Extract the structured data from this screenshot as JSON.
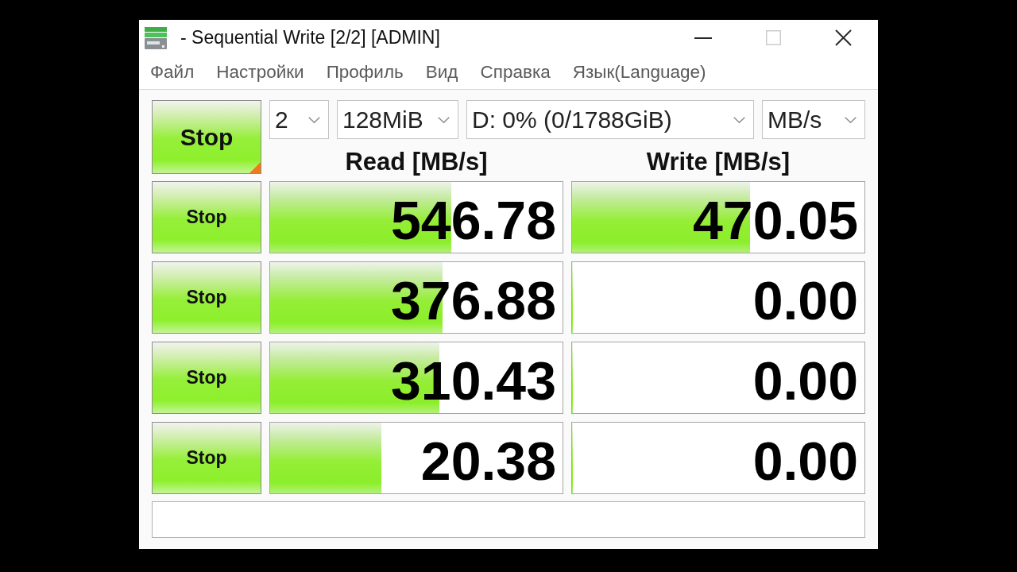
{
  "window": {
    "title": "- Sequential Write [2/2] [ADMIN]",
    "controls": [
      {
        "kind": "minimize",
        "disabled": false
      },
      {
        "kind": "maximize",
        "disabled": true
      },
      {
        "kind": "close",
        "disabled": false
      }
    ]
  },
  "menu": [
    "Файл",
    "Настройки",
    "Профиль",
    "Вид",
    "Справка",
    "Язык(Language)"
  ],
  "all_button": {
    "label": "Stop"
  },
  "settings": {
    "count": "2",
    "size": "128MiB",
    "drive": "D: 0% (0/1788GiB)",
    "unit": "MB/s"
  },
  "columns": [
    "Read [MB/s]",
    "Write [MB/s]"
  ],
  "tests": [
    {
      "button": "Stop",
      "read": {
        "value": "546.78",
        "level": 0.62
      },
      "write": {
        "value": "470.05",
        "level": 0.61
      }
    },
    {
      "button": "Stop",
      "read": {
        "value": "376.88",
        "level": 0.59
      },
      "write": {
        "value": "0.00",
        "level": 0
      }
    },
    {
      "button": "Stop",
      "read": {
        "value": "310.43",
        "level": 0.58
      },
      "write": {
        "value": "0.00",
        "level": 0
      }
    },
    {
      "button": "Stop",
      "read": {
        "value": "20.38",
        "level": 0.38
      },
      "write": {
        "value": "0.00",
        "level": 0
      }
    }
  ]
}
